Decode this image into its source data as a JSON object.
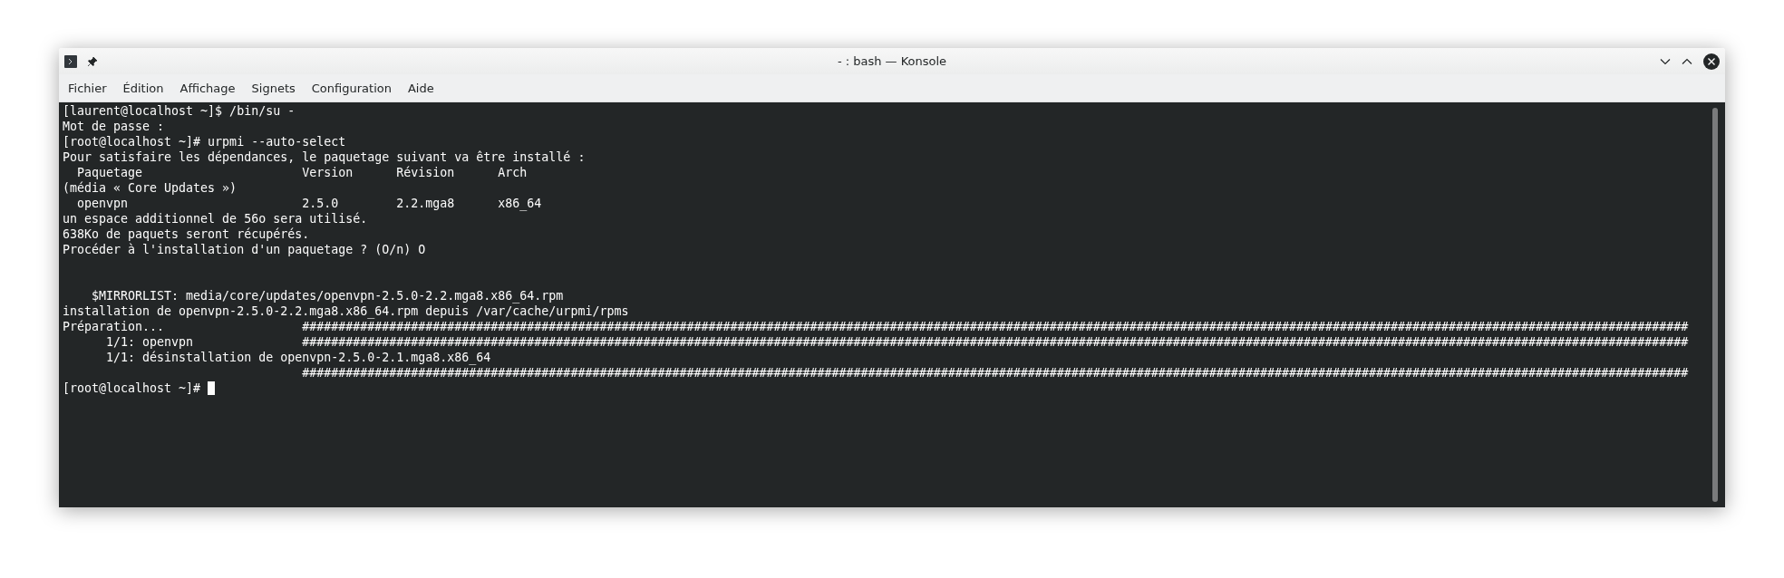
{
  "window": {
    "title": "- : bash — Konsole"
  },
  "menu": [
    "Fichier",
    "Édition",
    "Affichage",
    "Signets",
    "Configuration",
    "Aide"
  ],
  "terminal": {
    "lines": [
      {
        "kind": "text",
        "text": "[laurent@localhost ~]$ /bin/su -"
      },
      {
        "kind": "text",
        "text": "Mot de passe :"
      },
      {
        "kind": "text",
        "text": "[root@localhost ~]# urpmi --auto-select"
      },
      {
        "kind": "text",
        "text": "Pour satisfaire les dépendances, le paquetage suivant va être installé :"
      },
      {
        "kind": "text",
        "text": "  Paquetage                      Version      Révision      Arch"
      },
      {
        "kind": "text",
        "text": "(média « Core Updates »)"
      },
      {
        "kind": "text",
        "text": "  openvpn                        2.5.0        2.2.mga8      x86_64"
      },
      {
        "kind": "text",
        "text": "un espace additionnel de 56o sera utilisé."
      },
      {
        "kind": "text",
        "text": "638Ko de paquets seront récupérés."
      },
      {
        "kind": "text",
        "text": "Procéder à l'installation d'un paquetage ? (O/n) O"
      },
      {
        "kind": "blank"
      },
      {
        "kind": "blank"
      },
      {
        "kind": "text",
        "text": "    $MIRRORLIST: media/core/updates/openvpn-2.5.0-2.2.mga8.x86_64.rpm"
      },
      {
        "kind": "text",
        "text": "installation de openvpn-2.5.0-2.2.mga8.x86_64.rpm depuis /var/cache/urpmi/rpms"
      },
      {
        "kind": "text",
        "text": "Préparation...                   ###############################################################################################################################################################################################"
      },
      {
        "kind": "text",
        "text": "      1/1: openvpn               ###############################################################################################################################################################################################"
      },
      {
        "kind": "text",
        "text": "      1/1: désinstallation de openvpn-2.5.0-2.1.mga8.x86_64"
      },
      {
        "kind": "text",
        "text": "                                 ###############################################################################################################################################################################################"
      },
      {
        "kind": "text",
        "text": "[root@localhost ~]# "
      }
    ],
    "cursor": true
  }
}
